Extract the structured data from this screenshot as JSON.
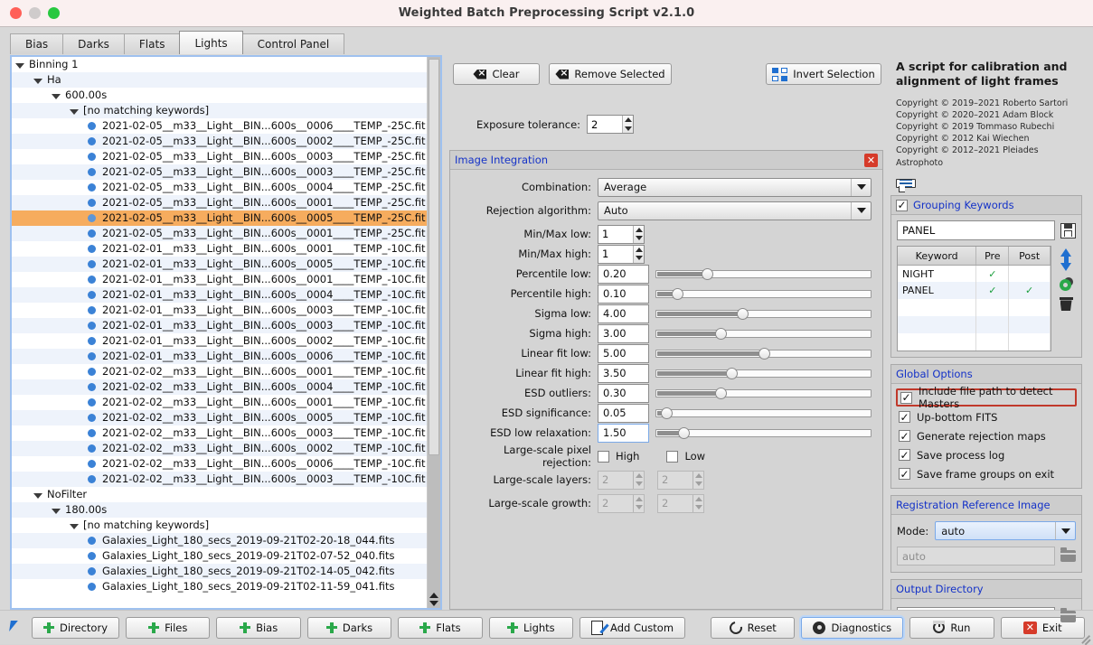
{
  "window": {
    "title": "Weighted Batch Preprocessing Script v2.1.0"
  },
  "tabs": [
    {
      "label": "Bias",
      "active": false
    },
    {
      "label": "Darks",
      "active": false
    },
    {
      "label": "Flats",
      "active": false
    },
    {
      "label": "Lights",
      "active": true
    },
    {
      "label": "Control Panel",
      "active": false
    }
  ],
  "tree": {
    "rows": [
      {
        "indent": 0,
        "type": "node",
        "label": "Binning 1"
      },
      {
        "indent": 1,
        "type": "node",
        "label": "Ha"
      },
      {
        "indent": 2,
        "type": "node",
        "label": "600.00s"
      },
      {
        "indent": 3,
        "type": "node",
        "label": "[no matching keywords]"
      },
      {
        "indent": 4,
        "type": "file",
        "label": "2021-02-05__m33__Light__BIN...600s__0006____TEMP_-25C.fit"
      },
      {
        "indent": 4,
        "type": "file",
        "label": "2021-02-05__m33__Light__BIN...600s__0002____TEMP_-25C.fit"
      },
      {
        "indent": 4,
        "type": "file",
        "label": "2021-02-05__m33__Light__BIN...600s__0003____TEMP_-25C.fit"
      },
      {
        "indent": 4,
        "type": "file",
        "label": "2021-02-05__m33__Light__BIN...600s__0003____TEMP_-25C.fit"
      },
      {
        "indent": 4,
        "type": "file",
        "label": "2021-02-05__m33__Light__BIN...600s__0004____TEMP_-25C.fit"
      },
      {
        "indent": 4,
        "type": "file",
        "label": "2021-02-05__m33__Light__BIN...600s__0001____TEMP_-25C.fit"
      },
      {
        "indent": 4,
        "type": "file",
        "label": "2021-02-05__m33__Light__BIN...600s__0005____TEMP_-25C.fit",
        "selected": true
      },
      {
        "indent": 4,
        "type": "file",
        "label": "2021-02-05__m33__Light__BIN...600s__0001____TEMP_-25C.fit"
      },
      {
        "indent": 4,
        "type": "file",
        "label": "2021-02-01__m33__Light__BIN...600s__0001____TEMP_-10C.fit"
      },
      {
        "indent": 4,
        "type": "file",
        "label": "2021-02-01__m33__Light__BIN...600s__0005____TEMP_-10C.fit"
      },
      {
        "indent": 4,
        "type": "file",
        "label": "2021-02-01__m33__Light__BIN...600s__0001____TEMP_-10C.fit"
      },
      {
        "indent": 4,
        "type": "file",
        "label": "2021-02-01__m33__Light__BIN...600s__0004____TEMP_-10C.fit"
      },
      {
        "indent": 4,
        "type": "file",
        "label": "2021-02-01__m33__Light__BIN...600s__0003____TEMP_-10C.fit"
      },
      {
        "indent": 4,
        "type": "file",
        "label": "2021-02-01__m33__Light__BIN...600s__0003____TEMP_-10C.fit"
      },
      {
        "indent": 4,
        "type": "file",
        "label": "2021-02-01__m33__Light__BIN...600s__0002____TEMP_-10C.fit"
      },
      {
        "indent": 4,
        "type": "file",
        "label": "2021-02-01__m33__Light__BIN...600s__0006____TEMP_-10C.fit"
      },
      {
        "indent": 4,
        "type": "file",
        "label": "2021-02-02__m33__Light__BIN...600s__0001____TEMP_-10C.fit"
      },
      {
        "indent": 4,
        "type": "file",
        "label": "2021-02-02__m33__Light__BIN...600s__0004____TEMP_-10C.fit"
      },
      {
        "indent": 4,
        "type": "file",
        "label": "2021-02-02__m33__Light__BIN...600s__0001____TEMP_-10C.fit"
      },
      {
        "indent": 4,
        "type": "file",
        "label": "2021-02-02__m33__Light__BIN...600s__0005____TEMP_-10C.fit"
      },
      {
        "indent": 4,
        "type": "file",
        "label": "2021-02-02__m33__Light__BIN...600s__0003____TEMP_-10C.fit"
      },
      {
        "indent": 4,
        "type": "file",
        "label": "2021-02-02__m33__Light__BIN...600s__0002____TEMP_-10C.fit"
      },
      {
        "indent": 4,
        "type": "file",
        "label": "2021-02-02__m33__Light__BIN...600s__0006____TEMP_-10C.fit"
      },
      {
        "indent": 4,
        "type": "file",
        "label": "2021-02-02__m33__Light__BIN...600s__0003____TEMP_-10C.fit"
      },
      {
        "indent": 1,
        "type": "node",
        "label": "NoFilter"
      },
      {
        "indent": 2,
        "type": "node",
        "label": "180.00s"
      },
      {
        "indent": 3,
        "type": "node",
        "label": "[no matching keywords]"
      },
      {
        "indent": 4,
        "type": "file",
        "label": "Galaxies_Light_180_secs_2019-09-21T02-20-18_044.fits"
      },
      {
        "indent": 4,
        "type": "file",
        "label": "Galaxies_Light_180_secs_2019-09-21T02-07-52_040.fits"
      },
      {
        "indent": 4,
        "type": "file",
        "label": "Galaxies_Light_180_secs_2019-09-21T02-14-05_042.fits"
      },
      {
        "indent": 4,
        "type": "file",
        "label": "Galaxies_Light_180_secs_2019-09-21T02-11-59_041.fits"
      }
    ]
  },
  "toolbar": {
    "clear_label": "Clear",
    "remove_selected_label": "Remove Selected",
    "invert_selection_label": "Invert Selection",
    "exposure_tolerance_label": "Exposure tolerance:",
    "exposure_tolerance_value": "2"
  },
  "integration": {
    "title": "Image Integration",
    "close_label": "✕",
    "combination_label": "Combination:",
    "combination_value": "Average",
    "rejection_label": "Rejection algorithm:",
    "rejection_value": "Auto",
    "sliders": [
      {
        "label": "Min/Max low:",
        "value": "1",
        "kind": "spin"
      },
      {
        "label": "Min/Max high:",
        "value": "1",
        "kind": "spin"
      },
      {
        "label": "Percentile low:",
        "value": "0.20",
        "kind": "slider",
        "pct": 24
      },
      {
        "label": "Percentile high:",
        "value": "0.10",
        "kind": "slider",
        "pct": 10
      },
      {
        "label": "Sigma low:",
        "value": "4.00",
        "kind": "slider",
        "pct": 40
      },
      {
        "label": "Sigma high:",
        "value": "3.00",
        "kind": "slider",
        "pct": 30
      },
      {
        "label": "Linear fit low:",
        "value": "5.00",
        "kind": "slider",
        "pct": 50
      },
      {
        "label": "Linear fit high:",
        "value": "3.50",
        "kind": "slider",
        "pct": 35
      },
      {
        "label": "ESD outliers:",
        "value": "0.30",
        "kind": "slider",
        "pct": 30
      },
      {
        "label": "ESD significance:",
        "value": "0.05",
        "kind": "slider",
        "pct": 5
      },
      {
        "label": "ESD low relaxation:",
        "value": "1.50",
        "kind": "slider",
        "pct": 13,
        "focused": true
      }
    ],
    "large_scale_rejection_label": "Large-scale pixel rejection:",
    "high_label": "High",
    "low_label": "Low",
    "large_scale_layers_label": "Large-scale layers:",
    "large_scale_layers_high": "2",
    "large_scale_layers_low": "2",
    "large_scale_growth_label": "Large-scale growth:",
    "large_scale_growth_high": "2",
    "large_scale_growth_low": "2"
  },
  "about": {
    "headline": "A script for calibration and alignment of light frames",
    "copyright": [
      "Copyright © 2019–2021 Roberto Sartori",
      "Copyright © 2020–2021 Adam Block",
      "Copyright © 2019 Tommaso Rubechi",
      "Copyright © 2012 Kai Wiechen",
      "Copyright © 2012–2021 Pleiades Astrophoto"
    ]
  },
  "grouping": {
    "title": "Grouping Keywords",
    "enabled": true,
    "input_value": "PANEL",
    "columns": [
      "Keyword",
      "Pre",
      "Post"
    ],
    "rows": [
      {
        "keyword": "NIGHT",
        "pre": "✓",
        "post": ""
      },
      {
        "keyword": "PANEL",
        "pre": "✓",
        "post": "✓"
      }
    ],
    "check_mark": "✓"
  },
  "global_options": {
    "title": "Global Options",
    "items": [
      {
        "label": "Include file path to detect Masters",
        "checked": true,
        "highlighted": true
      },
      {
        "label": "Up-bottom FITS",
        "checked": true
      },
      {
        "label": "Generate rejection maps",
        "checked": true
      },
      {
        "label": "Save process log",
        "checked": true
      },
      {
        "label": "Save frame groups on exit",
        "checked": true
      }
    ]
  },
  "registration": {
    "title": "Registration Reference Image",
    "mode_label": "Mode:",
    "mode_value": "auto",
    "path_placeholder": "auto"
  },
  "output": {
    "title": "Output Directory",
    "path_value": ""
  },
  "bottombar": {
    "buttons": [
      {
        "label": "Directory",
        "icon": "plus"
      },
      {
        "label": "Files",
        "icon": "plus"
      },
      {
        "label": "Bias",
        "icon": "plus"
      },
      {
        "label": "Darks",
        "icon": "plus"
      },
      {
        "label": "Flats",
        "icon": "plus"
      },
      {
        "label": "Lights",
        "icon": "plus"
      },
      {
        "label": "Add Custom",
        "icon": "pencil"
      },
      {
        "label": "Reset",
        "icon": "reset"
      },
      {
        "label": "Diagnostics",
        "icon": "gear",
        "focused": true
      },
      {
        "label": "Run",
        "icon": "power"
      },
      {
        "label": "Exit",
        "icon": "exit"
      }
    ]
  },
  "colors": {
    "accent_blue": "#1432c8",
    "selection_orange": "#f6ac5e",
    "highlight_red": "#c0392b",
    "green_check": "#1a9e3c",
    "bullet_blue": "#3b82d6"
  }
}
